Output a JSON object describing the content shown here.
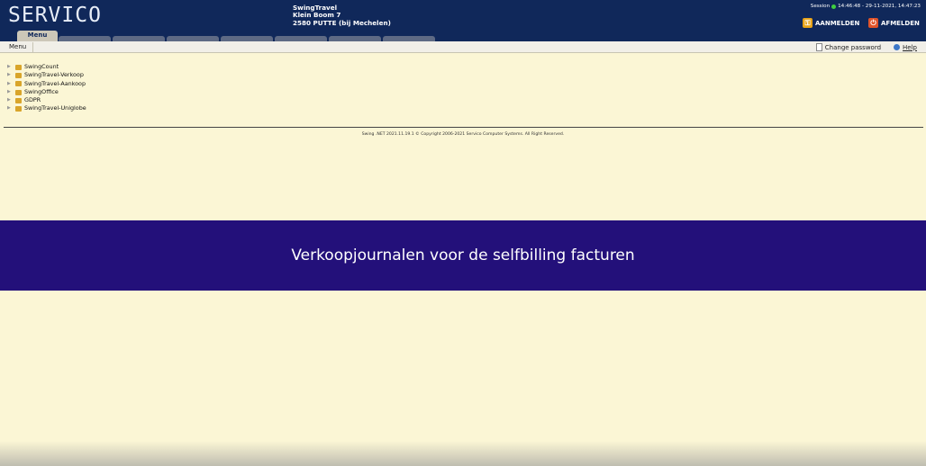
{
  "header": {
    "logo": "SERVICO",
    "company_name": "SwingTravel",
    "company_street": "Klein Boom 7",
    "company_city": "2580 PUTTE (bij Mechelen)",
    "session_label": "Session",
    "session_times": "14:46:48 - 29-11-2021, 14:47:23",
    "login_label": "AANMELDEN",
    "logout_label": "AFMELDEN"
  },
  "tabs": [
    {
      "label": "Menu",
      "active": true
    }
  ],
  "menubar": {
    "left_label": "Menu",
    "change_password": "Change password",
    "help": "Help"
  },
  "tree": [
    {
      "label": "SwingCount"
    },
    {
      "label": "SwingTravel-Verkoop"
    },
    {
      "label": "SwingTravel-Aankoop"
    },
    {
      "label": "SwingOffice"
    },
    {
      "label": "GDPR"
    },
    {
      "label": "SwingTravel-Uniglobe"
    }
  ],
  "footer": {
    "text": "Swing .NET 2021.11.19.1 © Copyright 2006-2021 Servico Computer Systems. All Right Reserved."
  },
  "banner": {
    "text": "Verkoopjournalen voor de selfbilling facturen"
  },
  "colors": {
    "header_bg": "#10285a",
    "page_bg": "#fbf6d5",
    "banner_bg": "#23107a",
    "login_icon": "#e8a317",
    "logout_icon": "#e0542a"
  }
}
